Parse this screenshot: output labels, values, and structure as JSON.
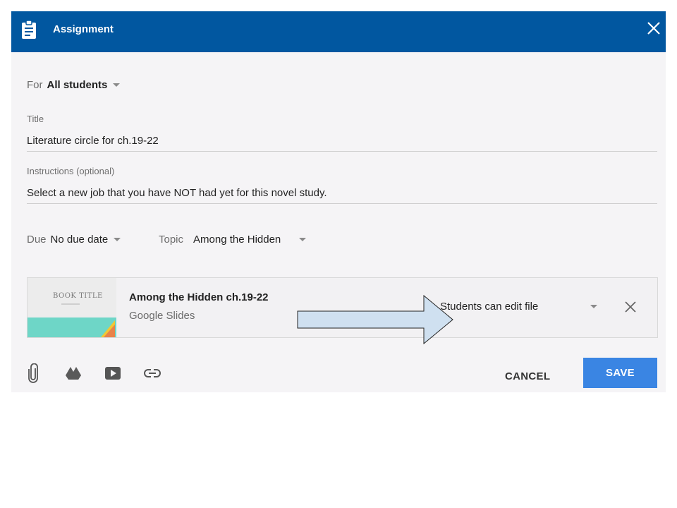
{
  "header": {
    "title": "Assignment"
  },
  "for": {
    "label": "For",
    "value": "All students"
  },
  "title_field": {
    "label": "Title",
    "value": "Literature circle for ch.19-22"
  },
  "instructions": {
    "label": "Instructions (optional)",
    "value": "Select a new job that you have NOT had yet for this novel study."
  },
  "due": {
    "label": "Due",
    "value": "No due date"
  },
  "topic": {
    "label": "Topic",
    "value": "Among the Hidden"
  },
  "attachment": {
    "thumb_title": "BOOK TITLE",
    "name": "Among the Hidden ch.19-22",
    "type": "Google Slides",
    "permission": "Students can edit file"
  },
  "footer": {
    "cancel": "CANCEL",
    "save": "SAVE"
  },
  "colors": {
    "header": "#0157a0",
    "save": "#3a85e3",
    "arrow_fill": "#cfe0f0"
  },
  "icons": [
    "clipboard-icon",
    "close-icon",
    "paperclip-icon",
    "drive-icon",
    "youtube-icon",
    "link-icon"
  ]
}
